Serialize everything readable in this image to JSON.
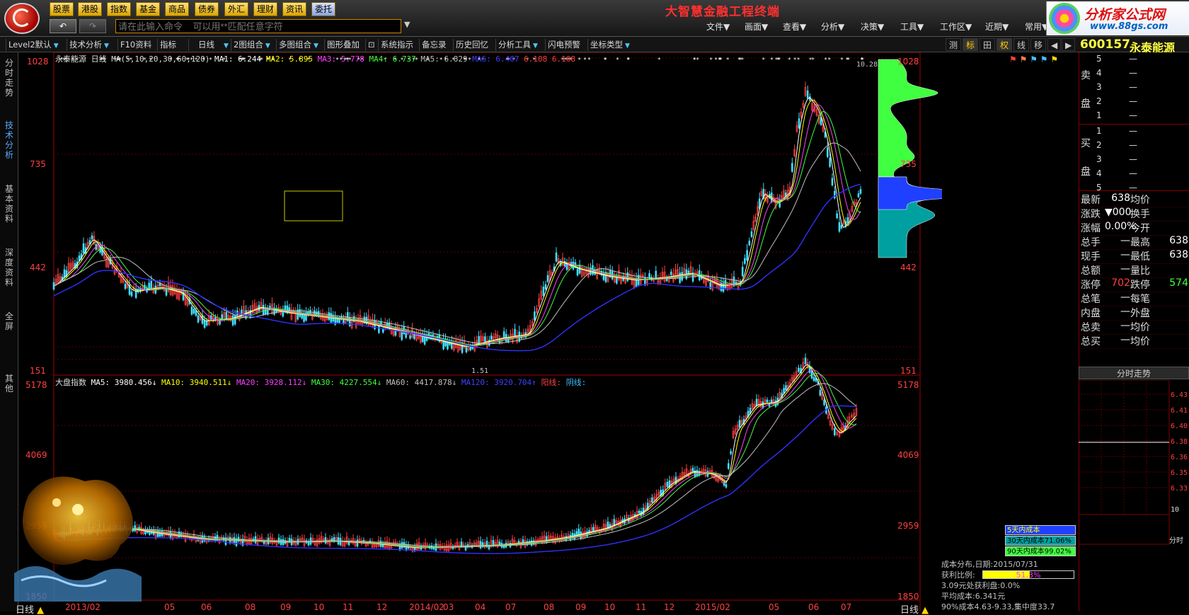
{
  "nav_buttons": [
    {
      "label": "股票"
    },
    {
      "label": "港股"
    },
    {
      "label": "指数"
    },
    {
      "label": "基金"
    },
    {
      "label": "商品"
    },
    {
      "label": "债券"
    },
    {
      "label": "外汇"
    },
    {
      "label": "理财"
    },
    {
      "label": "资讯"
    },
    {
      "label": "委托"
    }
  ],
  "command": {
    "placeholder": "请在此输入命令    可以用**匹配任意字符"
  },
  "app_title": "大智慧金融工程终端",
  "menus": [
    "文件▼",
    "画面▼",
    "查看▼",
    "分析▼",
    "决策▼",
    "工具▼",
    "工作区▼",
    "近期▼",
    "常用▼"
  ],
  "brand": {
    "name": "分析家公式网",
    "url": "www.88gs.com"
  },
  "toolbar": [
    "Level2默认",
    "技术分析",
    "F10资料",
    "指标",
    "日线",
    "2图组合",
    "多图组合",
    "图形叠加",
    "系统指示",
    "备忘录",
    "历史回忆",
    "分析工具",
    "闪电预警",
    "坐标类型"
  ],
  "toolbar_icons": [
    "测",
    "标",
    "田",
    "权",
    "线",
    "移"
  ],
  "side_tabs": [
    "分时走势",
    "技术分析",
    "基本资料",
    "深度资料",
    "全屏",
    "其他"
  ],
  "stock": {
    "code": "600157",
    "name": "永泰能源"
  },
  "main_chart": {
    "title": "永泰能源",
    "period": "日线",
    "ma_params": "MA(5,10,20,30,60,120)",
    "ma_items": [
      {
        "label": "MA1: 6.244",
        "color": "#ffffff"
      },
      {
        "label": "MA2: 5.895",
        "color": "#ffff00"
      },
      {
        "label": "MA3: 5.778",
        "color": "#ff40ff"
      },
      {
        "label": "MA4: 6.737",
        "color": "#40ff40"
      },
      {
        "label": "MA5: 6.829",
        "color": "#c0c0c0"
      },
      {
        "label": "MA6: 6.407",
        "color": "#4040ff"
      },
      {
        "label": "6.108",
        "color": "#ff4040"
      },
      {
        "label": "6.108",
        "color": "#ff4040"
      }
    ],
    "y_ticks": [
      "1028",
      "735",
      "442",
      "151"
    ],
    "high_label": "10.28",
    "low_label": "1.51"
  },
  "index_chart": {
    "title": "大盘指数",
    "ma_items": [
      {
        "label": "MA5: 3980.456↓",
        "color": "#ffffff"
      },
      {
        "label": "MA10: 3940.511↓",
        "color": "#ffff00"
      },
      {
        "label": "MA20: 3928.112↓",
        "color": "#ff40ff"
      },
      {
        "label": "MA30: 4227.554↓",
        "color": "#40ff40"
      },
      {
        "label": "MA60: 4417.878↓",
        "color": "#c0c0c0"
      },
      {
        "label": "MA120: 3920.704↑",
        "color": "#4040ff"
      },
      {
        "label": "阳线:",
        "color": "#ff4040"
      },
      {
        "label": "阴线:",
        "color": "#40c0ff"
      }
    ],
    "y_ticks": [
      "5178",
      "4069",
      "2959",
      "1850"
    ]
  },
  "x_axis": [
    "2013/02",
    "05",
    "06",
    "08",
    "09",
    "10",
    "11",
    "12",
    "2014/02",
    "03",
    "04",
    "07",
    "08",
    "09",
    "10",
    "11",
    "12",
    "2015/02",
    "05",
    "06",
    "07"
  ],
  "period_label": "日线",
  "orderbook": {
    "sell_label": [
      "卖",
      "盘"
    ],
    "buy_label": [
      "买",
      "盘"
    ],
    "sell_levels": [
      "5",
      "4",
      "3",
      "2",
      "1"
    ],
    "buy_levels": [
      "1",
      "2",
      "3",
      "4",
      "5"
    ],
    "placeholder": "—"
  },
  "quotes": [
    {
      "l1": "最新",
      "v1": "638",
      "l2": "均价",
      "v2": "",
      "c1": "#ffffff"
    },
    {
      "l1": "涨跌",
      "v1": "▼000",
      "l2": "换手",
      "v2": "",
      "c1": "#ffffff"
    },
    {
      "l1": "涨幅",
      "v1": "0.00%",
      "l2": "今开",
      "v2": "",
      "c1": "#ffffff"
    },
    {
      "l1": "总手",
      "v1": "—",
      "l2": "最高",
      "v2": "638",
      "c1": "#ffffff"
    },
    {
      "l1": "现手",
      "v1": "—",
      "l2": "最低",
      "v2": "638",
      "c1": "#ffffff"
    },
    {
      "l1": "总额",
      "v1": "—",
      "l2": "量比",
      "v2": "",
      "c1": "#ffffff"
    },
    {
      "l1": "涨停",
      "v1": "702",
      "l2": "跌停",
      "v2": "574",
      "c1": "#ff4040",
      "c2": "#40ff40"
    },
    {
      "l1": "总笔",
      "v1": "—",
      "l2": "每笔",
      "v2": "",
      "c1": "#ffffff"
    },
    {
      "l1": "内盘",
      "v1": "—",
      "l2": "外盘",
      "v2": "",
      "c1": "#ffffff"
    },
    {
      "l1": "总卖",
      "v1": "—",
      "l2": "均价",
      "v2": "",
      "c1": "#ffffff"
    },
    {
      "l1": "总买",
      "v1": "—",
      "l2": "均价",
      "v2": "",
      "c1": "#ffffff"
    }
  ],
  "intraday": {
    "tab": "分时走势",
    "y_ticks": [
      "6.43",
      "6.41",
      "6.40",
      "6.38",
      "6.36",
      "6.35",
      "6.33"
    ],
    "vol_tick": "10",
    "x_label": "分时"
  },
  "cost_distribution": {
    "legend": [
      {
        "label": "5天内成本",
        "color": "#2040ff"
      },
      {
        "label": "30天内成本71.06%",
        "color": "#00a0a0"
      },
      {
        "label": "90天内成本99.02%",
        "color": "#40ff40"
      }
    ],
    "title": "成本分布,日期:2015/07/31",
    "profit_label": "获利比例:",
    "profit_value": "51.3%",
    "profit_fraction": 0.513,
    "line1": "3.09元处获利盘:0.0%",
    "line2": "平均成本:6.341元",
    "line3": "90%成本4.63-9.33,集中度33.7"
  },
  "colors": {
    "up": "#ff4040",
    "down": "#40e0ff",
    "grid": "#800000"
  }
}
